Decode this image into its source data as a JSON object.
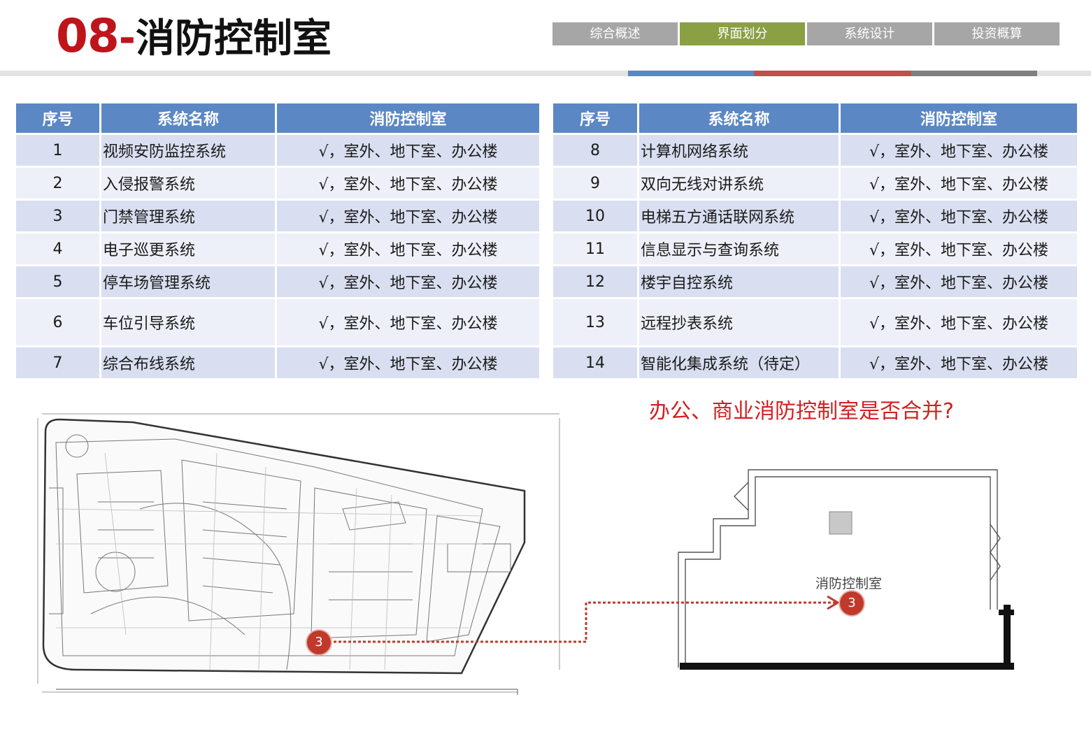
{
  "header": {
    "title_num": "08",
    "title_dash": "-",
    "title_text": "消防控制室",
    "nav_tabs": [
      "综合概述",
      "界面划分",
      "系统设计",
      "投资概算"
    ],
    "active_tab": "界面划分"
  },
  "colors": {
    "accent_red": "#c0141b",
    "nav_active": "#8aa042",
    "nav_inactive": "#a6a6a6",
    "table_header": "#5b87c4",
    "row_dark": "#d9dff0",
    "row_light": "#edf0f8",
    "bar_blue": "#5b87c4",
    "bar_red": "#c0504d",
    "bar_gray": "#7f7f7f"
  },
  "table_left": {
    "headers": [
      "序号",
      "系统名称",
      "消防控制室"
    ],
    "rows": [
      [
        "1",
        "视频安防监控系统",
        "√，室外、地下室、办公楼"
      ],
      [
        "2",
        "入侵报警系统",
        "√，室外、地下室、办公楼"
      ],
      [
        "3",
        "门禁管理系统",
        "√，室外、地下室、办公楼"
      ],
      [
        "4",
        "电子巡更系统",
        "√，室外、地下室、办公楼"
      ],
      [
        "5",
        "停车场管理系统",
        "√，室外、地下室、办公楼"
      ],
      [
        "6",
        "车位引导系统",
        "√，室外、地下室、办公楼"
      ],
      [
        "7",
        "综合布线系统",
        "√，室外、地下室、办公楼"
      ]
    ]
  },
  "table_right": {
    "headers": [
      "序号",
      "系统名称",
      "消防控制室"
    ],
    "rows": [
      [
        "8",
        "计算机网络系统",
        "√，室外、地下室、办公楼"
      ],
      [
        "9",
        "双向无线对讲系统",
        "√，室外、地下室、办公楼"
      ],
      [
        "10",
        "电梯五方通话联网系统",
        "√，室外、地下室、办公楼"
      ],
      [
        "11",
        "信息显示与查询系统",
        "√，室外、地下室、办公楼"
      ],
      [
        "12",
        "楼宇自控系统",
        "√，室外、地下室、办公楼"
      ],
      [
        "13",
        "远程抄表系统",
        "√，室外、地下室、办公楼"
      ],
      [
        "14",
        "智能化集成系统（待定）",
        "√，室外、地下室、办公楼"
      ]
    ]
  },
  "question": "办公、商业消防控制室是否合并?",
  "room_label": "消防控制室",
  "marker_number": "3"
}
